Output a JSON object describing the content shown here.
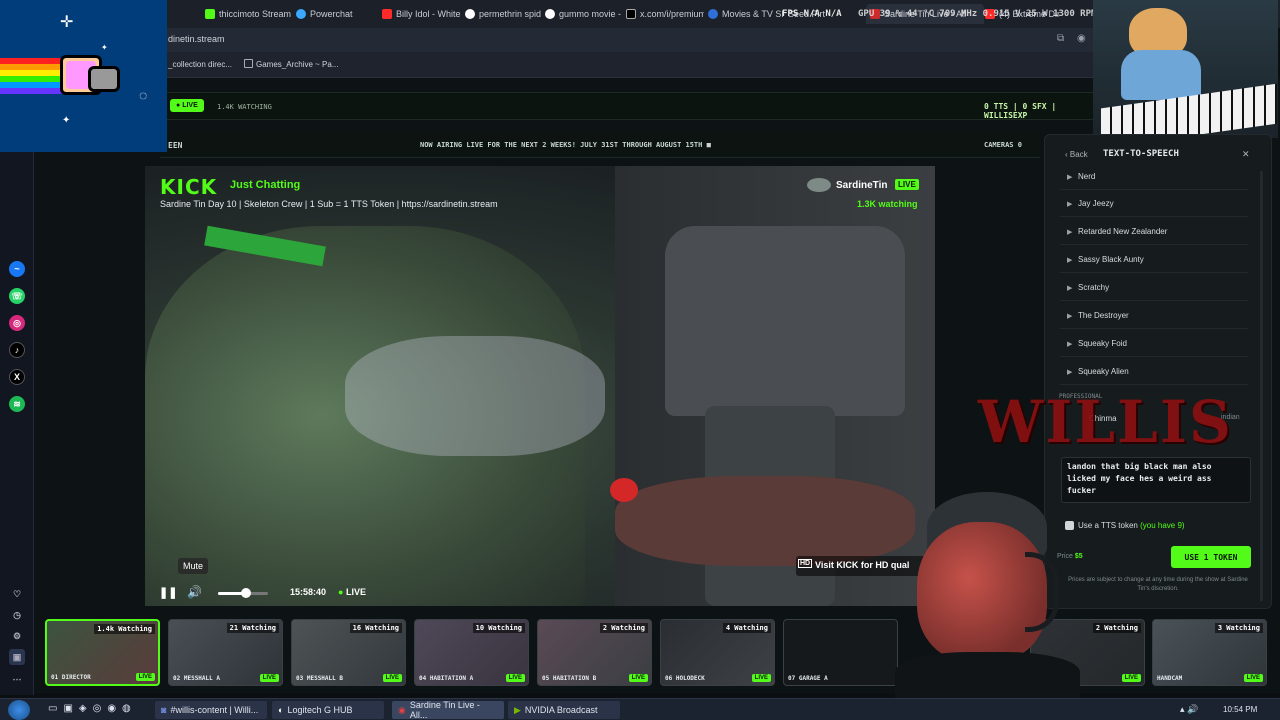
{
  "browser": {
    "tabs": [
      {
        "label": "thiccimoto Stream",
        "color": "#53fc18"
      },
      {
        "label": "Powerchat",
        "color": "#3aa9ff"
      },
      {
        "label": "Billy Idol - White",
        "color": "#ff2a2a"
      },
      {
        "label": "permethrin spide",
        "color": "#ffffff"
      },
      {
        "label": "gummo movie - c",
        "color": "#ffffff"
      },
      {
        "label": "x.com/i/premium",
        "color": "#000000"
      },
      {
        "label": "Movies & TV Sho",
        "color": "#2f6fd6"
      },
      {
        "label": "Seed Pirt",
        "color": "#888888"
      },
      {
        "label": "Sardine Tin Live - All",
        "color": "#cc2b2b"
      },
      {
        "label": "(4) Extreme Dir",
        "color": "#ff2a2a"
      }
    ],
    "address": "dinetin.stream",
    "bookmarks": [
      "_collection direc...",
      "Games_Archive ~ Pa..."
    ]
  },
  "overlay": {
    "fps_text": "FPS  N/A  N/A",
    "gpu_text": "GPU 39 % 44 °C 709 MHz 0.915 V 25 W 1300 RPM"
  },
  "site": {
    "live_label": "LIVE",
    "watching_top": "1.4K WATCHING",
    "right_stats": "0 TTS | 0 SFX | WILLISEXP",
    "ticker_left": "EEN",
    "ticker": "NOW AIRING LIVE FOR THE NEXT 2 WEEKS! JULY 31ST THROUGH AUGUST 15TH ■",
    "cameras_label": "CAMERAS 0"
  },
  "player": {
    "brand": "KICK",
    "category": "Just Chatting",
    "stream_title": "Sardine Tin Day 10 | Skeleton Crew | 1 Sub = 1 TTS Token | https://sardinetin.stream",
    "channel": "SardineTin",
    "live": "LIVE",
    "viewers": "1.3K watching",
    "tooltip": "Mute",
    "time": "15:58:40",
    "live_indicator": "LIVE",
    "hd_label": "HD",
    "hd_text": "Visit KICK for HD qual",
    "volume_level": 0.55
  },
  "tts": {
    "back": "Back",
    "title": "TEXT-TO-SPEECH",
    "close": "✕",
    "voices": [
      "Nerd",
      "Jay Jeezy",
      "Retarded New Zealander",
      "Sassy Black Aunty",
      "Scratchy",
      "The Destroyer",
      "Squeaky Foid",
      "Squeaky Alien"
    ],
    "section_label": "PROFESSIONAL",
    "partial_voice": "Chinma",
    "partial_tag": "indian",
    "message": "landon that big black man also licked my face hes a weird ass fucker",
    "token_label_start": "Use a TTS token",
    "token_label_end": "(you have 9)",
    "price_label": "Price",
    "price": "$5",
    "use_button": "USE 1 TOKEN",
    "fine_print": "Prices are subject to change at any time during the show at Sardine Tin's discretion."
  },
  "watermark": "WILLIS",
  "cameras": [
    {
      "watching": "1.4k Watching",
      "name": "DIRECTOR",
      "num": "01"
    },
    {
      "watching": "21 Watching",
      "name": "MESSHALL A",
      "num": "02"
    },
    {
      "watching": "16 Watching",
      "name": "MESSHALL B",
      "num": "03"
    },
    {
      "watching": "10 Watching",
      "name": "HABITATION A",
      "num": "04"
    },
    {
      "watching": "2 Watching",
      "name": "HABITATION B",
      "num": "05"
    },
    {
      "watching": "4 Watching",
      "name": "HOLODECK",
      "num": "06"
    },
    {
      "watching": "",
      "name": "GARAGE A",
      "num": "07"
    },
    {
      "watching": "2 Watching",
      "name": "",
      "num": ""
    },
    {
      "watching": "3 Watching",
      "name": "HANDCAM",
      "num": ""
    }
  ],
  "cam_live": "LIVE",
  "taskbar": {
    "items": [
      "#willis-content | Willi...",
      "Logitech G HUB",
      "Sardine Tin Live - All...",
      "NVIDIA Broadcast"
    ],
    "clock": "10:54 PM"
  }
}
